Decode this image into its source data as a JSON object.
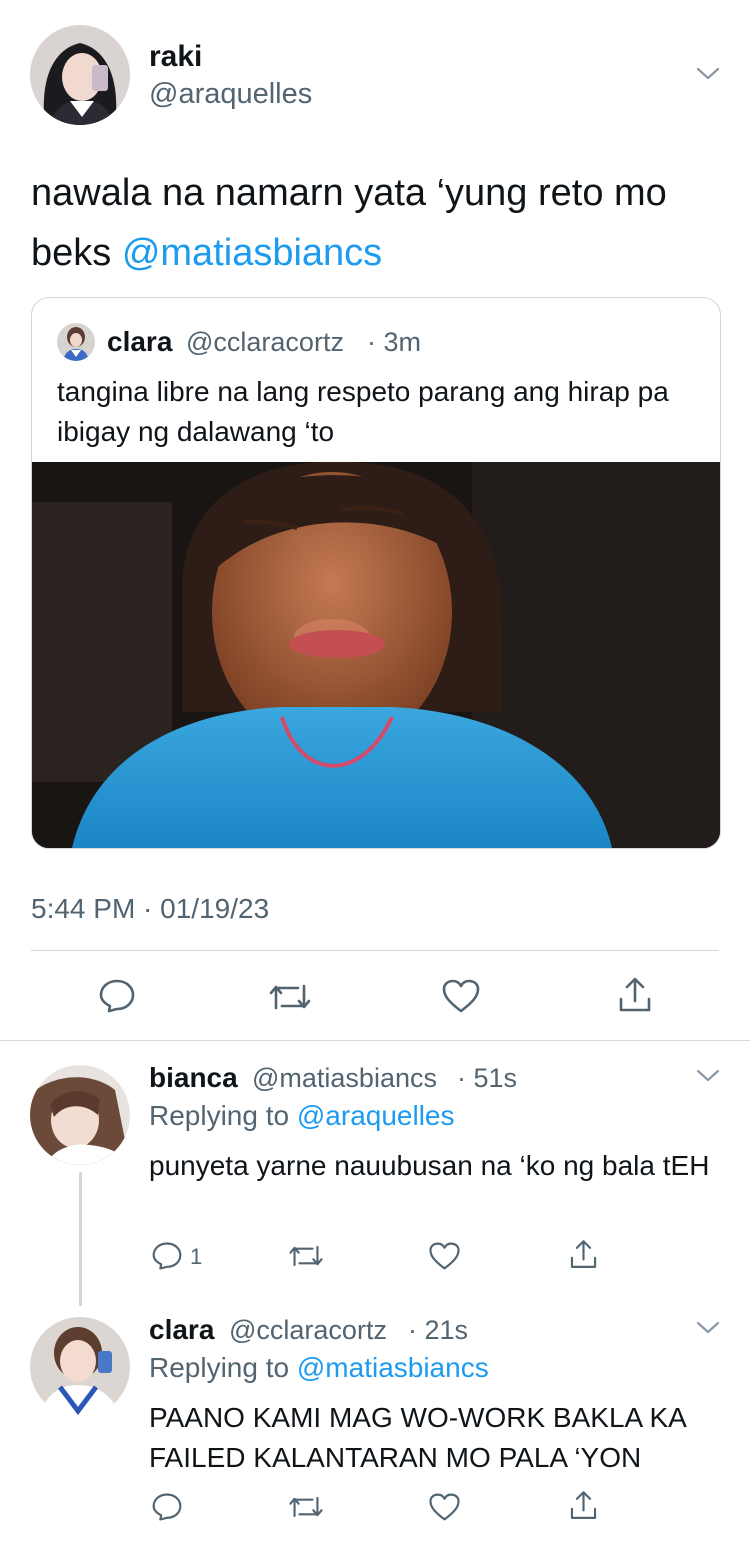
{
  "main_tweet": {
    "display_name": "raki",
    "handle": "@araquelles",
    "text_part1": "nawala na namarn yata ‘yung reto mo beks ",
    "mention": "@matiasbiancs",
    "timestamp": "5:44 PM · 01/19/23"
  },
  "quoted_tweet": {
    "display_name": "clara",
    "handle": "@cclaracortz",
    "time": "· 3m",
    "text": "tangina libre na lang respeto parang ang hirap pa ibigay ng dalawang ‘to"
  },
  "replies": [
    {
      "display_name": "bianca",
      "handle": "@matiasbiancs",
      "time": "· 51s",
      "replying_label": "Replying to ",
      "replying_to": "@araquelles",
      "text": "punyeta yarne nauubusan na ‘ko ng bala tEH",
      "reply_count": "1"
    },
    {
      "display_name": "clara",
      "handle": "@cclaracortz",
      "time": "· 21s",
      "replying_label": "Replying to ",
      "replying_to": "@matiasbiancs",
      "text": "PAANO KAMI MAG WO-WORK BAKLA KA FAILED KALANTARAN MO PALA ‘YON",
      "reply_count": ""
    }
  ],
  "colors": {
    "accent": "#1d9bf0",
    "muted": "#536471",
    "divider": "#cfd9de"
  },
  "icons": [
    "chevron-down-icon",
    "reply-icon",
    "retweet-icon",
    "like-icon",
    "share-icon"
  ]
}
